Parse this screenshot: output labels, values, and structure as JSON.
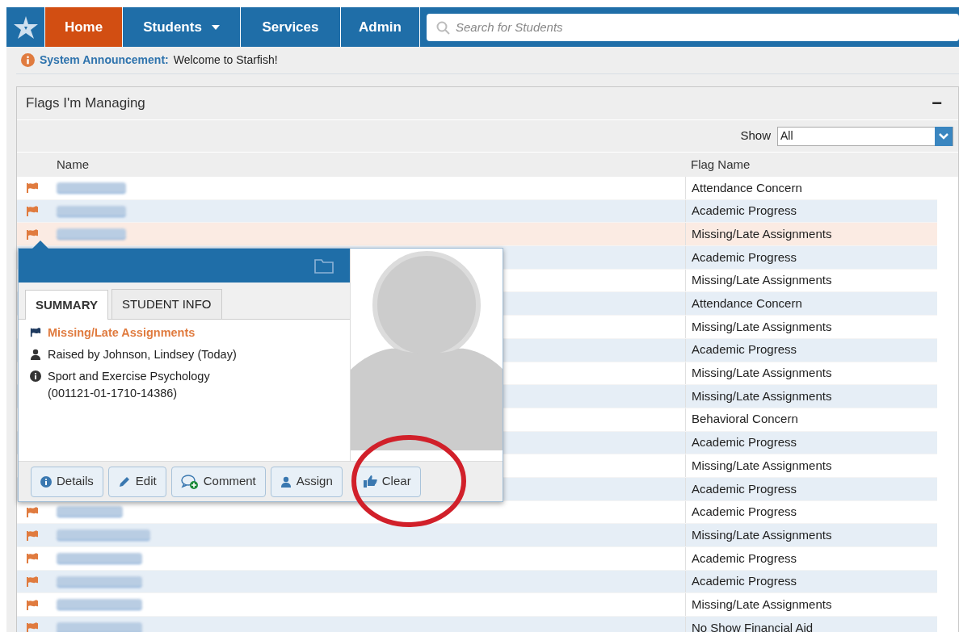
{
  "nav": {
    "items": [
      {
        "label": "Home",
        "selected": true,
        "dropdown": false
      },
      {
        "label": "Students",
        "selected": false,
        "dropdown": true
      },
      {
        "label": "Services",
        "selected": false,
        "dropdown": false
      },
      {
        "label": "Admin",
        "selected": false,
        "dropdown": false
      }
    ],
    "search": {
      "placeholder": "Search for Students"
    }
  },
  "announcement": {
    "label": "System Announcement:",
    "text": "Welcome to Starfish!"
  },
  "panel": {
    "title": "Flags I'm Managing",
    "collapse": "−",
    "filter": {
      "label": "Show",
      "value": "All"
    },
    "columns": [
      "Name",
      "Flag Name"
    ],
    "rows": [
      {
        "flag": "Attendance Concern",
        "selected": false
      },
      {
        "flag": "Academic Progress",
        "selected": false
      },
      {
        "flag": "Missing/Late Assignments",
        "selected": true
      },
      {
        "flag": "Academic Progress",
        "selected": false
      },
      {
        "flag": "Missing/Late Assignments",
        "selected": false
      },
      {
        "flag": "Attendance Concern",
        "selected": false
      },
      {
        "flag": "Missing/Late Assignments",
        "selected": false
      },
      {
        "flag": "Academic Progress",
        "selected": false
      },
      {
        "flag": "Missing/Late Assignments",
        "selected": false
      },
      {
        "flag": "Missing/Late Assignments",
        "selected": false
      },
      {
        "flag": "Behavioral Concern",
        "selected": false
      },
      {
        "flag": "Academic Progress",
        "selected": false
      },
      {
        "flag": "Missing/Late Assignments",
        "selected": false
      },
      {
        "flag": "Academic Progress",
        "selected": false
      },
      {
        "flag": "Academic Progress",
        "selected": false
      },
      {
        "flag": "Missing/Late Assignments",
        "selected": false
      },
      {
        "flag": "Academic Progress",
        "selected": false
      },
      {
        "flag": "Academic Progress",
        "selected": false
      },
      {
        "flag": "Missing/Late Assignments",
        "selected": false
      },
      {
        "flag": "No Show Financial Aid",
        "selected": false
      }
    ]
  },
  "popup": {
    "tabs": [
      {
        "label": "SUMMARY",
        "selected": true
      },
      {
        "label": "STUDENT INFO",
        "selected": false
      }
    ],
    "summary": [
      {
        "kind": "flag",
        "text": "Missing/Late Assignments"
      },
      {
        "kind": "person",
        "text": "Raised by Johnson, Lindsey (Today)"
      },
      {
        "kind": "info",
        "text": "Sport and Exercise Psychology (001121-01-1710-14386)"
      }
    ],
    "buttons": [
      {
        "kind": "details",
        "label": "Details"
      },
      {
        "kind": "edit",
        "label": "Edit"
      },
      {
        "kind": "comment",
        "label": "Comment"
      },
      {
        "kind": "assign",
        "label": "Assign"
      },
      {
        "kind": "clear",
        "label": "Clear"
      }
    ]
  }
}
